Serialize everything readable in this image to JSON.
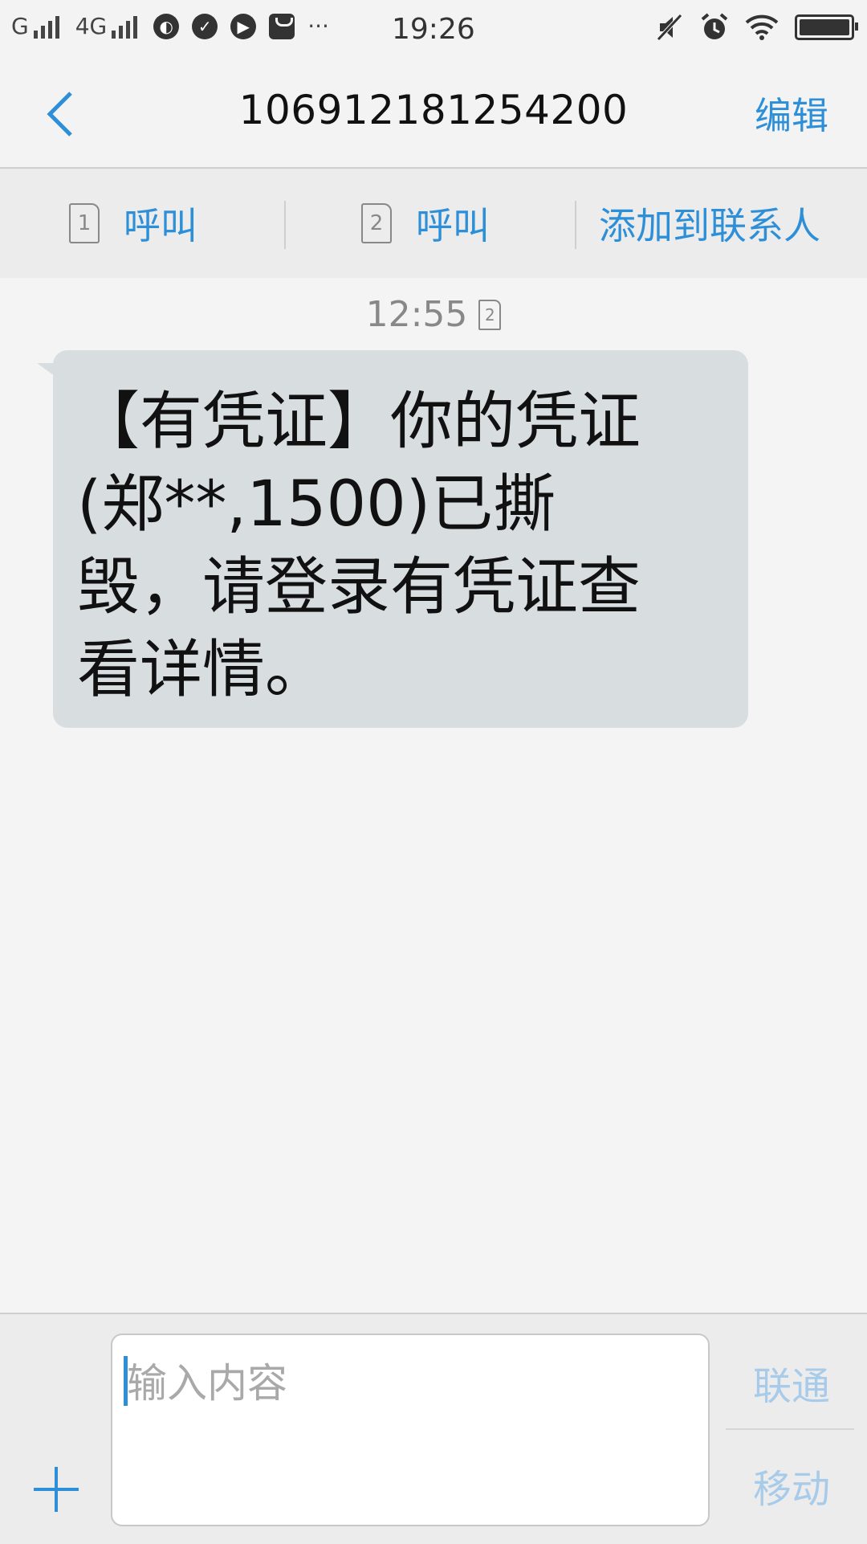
{
  "status_bar": {
    "carrier1": "G",
    "carrier2": "4G",
    "more": "···",
    "time": "19:26"
  },
  "header": {
    "title": "106912181254200",
    "edit_label": "编辑"
  },
  "actions": {
    "call1": {
      "sim": "1",
      "label": "呼叫"
    },
    "call2": {
      "sim": "2",
      "label": "呼叫"
    },
    "add_contact": "添加到联系人"
  },
  "conversation": {
    "messages": [
      {
        "time": "12:55",
        "sim": "2",
        "text": "【有凭证】你的凭证(郑**,1500)已撕毁，请登录有凭证查看详情。"
      }
    ]
  },
  "compose": {
    "placeholder": "输入内容",
    "send_sim1": "联通",
    "send_sim2": "移动"
  },
  "colors": {
    "accent": "#2d8fd8",
    "bubble": "#d8dee0",
    "background": "#f4f4f4"
  }
}
